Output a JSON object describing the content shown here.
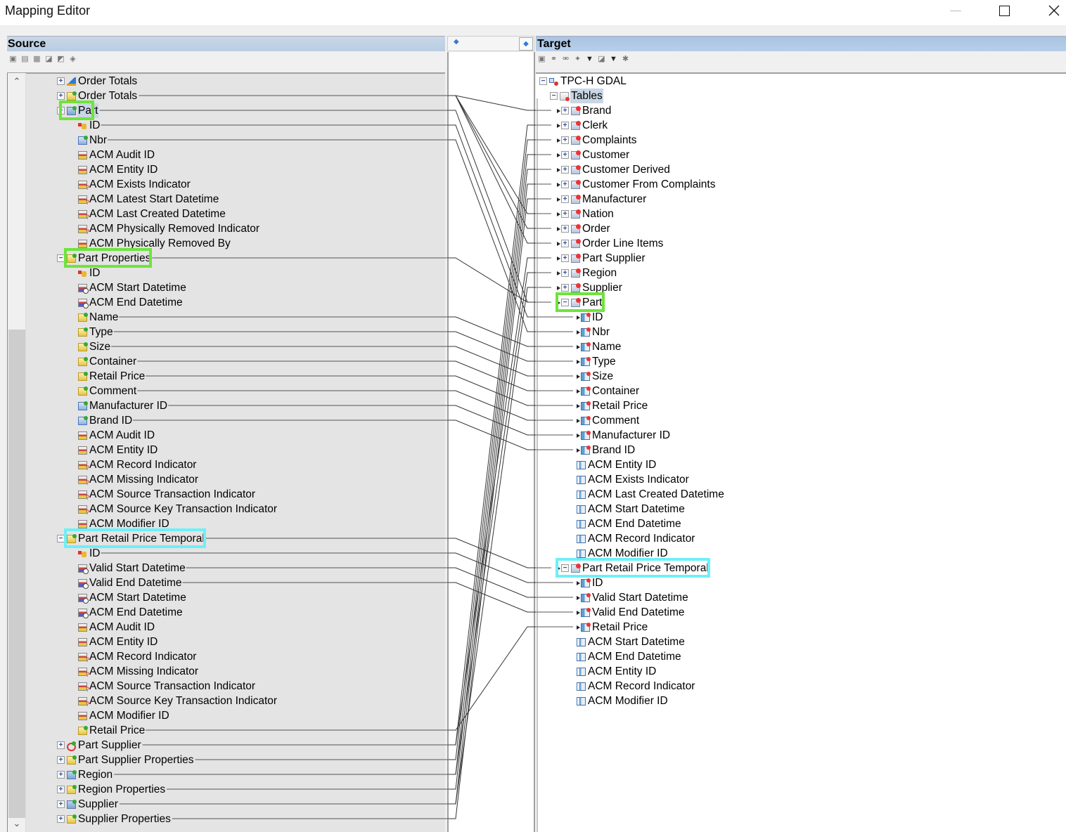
{
  "window": {
    "title": "Mapping Editor",
    "controls": [
      "minimize",
      "maximize",
      "close"
    ]
  },
  "source": {
    "header": "Source",
    "toolbar_icons": [
      "new-entity-icon",
      "new-table-icon",
      "delete-icon",
      "import-icon",
      "export-icon",
      "add-mapping-icon"
    ],
    "rows": [
      {
        "label": "Order Totals",
        "level": 0,
        "expander": "+",
        "icon": "chart",
        "mapped": false
      },
      {
        "label": "Order Totals",
        "level": 0,
        "expander": "+",
        "icon": "props",
        "mapped": true
      },
      {
        "label": "Part",
        "level": 0,
        "expander": "-",
        "icon": "entity",
        "mapped": true,
        "selected": true,
        "highlight": "green"
      },
      {
        "label": "ID",
        "level": 1,
        "icon": "key",
        "mapped": true
      },
      {
        "label": "Nbr",
        "level": 1,
        "icon": "bluefld",
        "mapped": true
      },
      {
        "label": "ACM Audit ID",
        "level": 1,
        "icon": "attr",
        "mapped": false
      },
      {
        "label": "ACM Entity ID",
        "level": 1,
        "icon": "attr",
        "mapped": false
      },
      {
        "label": "ACM Exists Indicator",
        "level": 1,
        "icon": "attrq",
        "mapped": false
      },
      {
        "label": "ACM Latest Start Datetime",
        "level": 1,
        "icon": "attrq",
        "mapped": false
      },
      {
        "label": "ACM Last Created Datetime",
        "level": 1,
        "icon": "attrq",
        "mapped": false
      },
      {
        "label": "ACM Physically Removed Indicator",
        "level": 1,
        "icon": "attrq",
        "mapped": false
      },
      {
        "label": "ACM Physically Removed By",
        "level": 1,
        "icon": "attr",
        "mapped": false
      },
      {
        "label": "Part Properties",
        "level": 0,
        "expander": "-",
        "icon": "props",
        "mapped": true,
        "highlight": "green"
      },
      {
        "label": "ID",
        "level": 1,
        "icon": "key",
        "mapped": false
      },
      {
        "label": "ACM Start Datetime",
        "level": 1,
        "icon": "attrt",
        "mapped": false
      },
      {
        "label": "ACM End Datetime",
        "level": 1,
        "icon": "attrt",
        "mapped": false
      },
      {
        "label": "Name",
        "level": 1,
        "icon": "props",
        "mapped": true
      },
      {
        "label": "Type",
        "level": 1,
        "icon": "props",
        "mapped": true
      },
      {
        "label": "Size",
        "level": 1,
        "icon": "props",
        "mapped": true
      },
      {
        "label": "Container",
        "level": 1,
        "icon": "props",
        "mapped": true
      },
      {
        "label": "Retail Price",
        "level": 1,
        "icon": "props",
        "mapped": true
      },
      {
        "label": "Comment",
        "level": 1,
        "icon": "props",
        "mapped": true
      },
      {
        "label": "Manufacturer ID",
        "level": 1,
        "icon": "bluefld",
        "mapped": true
      },
      {
        "label": "Brand ID",
        "level": 1,
        "icon": "bluefld",
        "mapped": true
      },
      {
        "label": "ACM Audit ID",
        "level": 1,
        "icon": "attr",
        "mapped": false
      },
      {
        "label": "ACM Entity ID",
        "level": 1,
        "icon": "attr",
        "mapped": false
      },
      {
        "label": "ACM Record Indicator",
        "level": 1,
        "icon": "attrq",
        "mapped": false
      },
      {
        "label": "ACM Missing Indicator",
        "level": 1,
        "icon": "attrq",
        "mapped": false
      },
      {
        "label": "ACM Source Transaction Indicator",
        "level": 1,
        "icon": "attrq",
        "mapped": false
      },
      {
        "label": "ACM Source Key Transaction Indicator",
        "level": 1,
        "icon": "attrq",
        "mapped": false
      },
      {
        "label": "ACM Modifier ID",
        "level": 1,
        "icon": "attr",
        "mapped": false
      },
      {
        "label": "Part Retail Price Temporal",
        "level": 0,
        "expander": "-",
        "icon": "props",
        "mapped": true,
        "highlight": "cyan"
      },
      {
        "label": "ID",
        "level": 1,
        "icon": "key",
        "mapped": true
      },
      {
        "label": "Valid Start Datetime",
        "level": 1,
        "icon": "attrt",
        "mapped": true
      },
      {
        "label": "Valid End Datetime",
        "level": 1,
        "icon": "attrt",
        "mapped": true
      },
      {
        "label": "ACM Start Datetime",
        "level": 1,
        "icon": "attrt",
        "mapped": false
      },
      {
        "label": "ACM End Datetime",
        "level": 1,
        "icon": "attrt",
        "mapped": false
      },
      {
        "label": "ACM Audit ID",
        "level": 1,
        "icon": "attr",
        "mapped": false
      },
      {
        "label": "ACM Entity ID",
        "level": 1,
        "icon": "attr",
        "mapped": false
      },
      {
        "label": "ACM Record Indicator",
        "level": 1,
        "icon": "attrq",
        "mapped": false
      },
      {
        "label": "ACM Missing Indicator",
        "level": 1,
        "icon": "attrq",
        "mapped": false
      },
      {
        "label": "ACM Source Transaction Indicator",
        "level": 1,
        "icon": "attrq",
        "mapped": false
      },
      {
        "label": "ACM Source Key Transaction Indicator",
        "level": 1,
        "icon": "attrq",
        "mapped": false
      },
      {
        "label": "ACM Modifier ID",
        "level": 1,
        "icon": "attr",
        "mapped": false
      },
      {
        "label": "Retail Price",
        "level": 1,
        "icon": "props",
        "mapped": true
      },
      {
        "label": "Part Supplier",
        "level": 0,
        "expander": "+",
        "icon": "rel",
        "mapped": true
      },
      {
        "label": "Part Supplier Properties",
        "level": 0,
        "expander": "+",
        "icon": "props",
        "mapped": true
      },
      {
        "label": "Region",
        "level": 0,
        "expander": "+",
        "icon": "entity",
        "mapped": true
      },
      {
        "label": "Region Properties",
        "level": 0,
        "expander": "+",
        "icon": "props",
        "mapped": true
      },
      {
        "label": "Supplier",
        "level": 0,
        "expander": "+",
        "icon": "entity",
        "mapped": true
      },
      {
        "label": "Supplier Properties",
        "level": 0,
        "expander": "+",
        "icon": "props",
        "mapped": true
      }
    ]
  },
  "middle": {
    "left_arrow": "◆",
    "right_arrow": "◆"
  },
  "target": {
    "header": "Target",
    "toolbar_icons": [
      "new-icon",
      "link-icon",
      "unlink-icon",
      "auto-map-icon",
      "dropdown-icon",
      "filter-icon",
      "dropdown-icon",
      "settings-icon"
    ],
    "rows": [
      {
        "label": "TPC-H GDAL",
        "level": 0,
        "expander": "-",
        "icon": "model",
        "mapped": false
      },
      {
        "label": "Tables",
        "level": 1,
        "expander": "-",
        "icon": "folder",
        "mapped": false,
        "selected": true
      },
      {
        "label": "Brand",
        "level": 2,
        "expander": "+",
        "icon": "table",
        "mapped": true
      },
      {
        "label": "Clerk",
        "level": 2,
        "expander": "+",
        "icon": "table",
        "mapped": true
      },
      {
        "label": "Complaints",
        "level": 2,
        "expander": "+",
        "icon": "table",
        "mapped": true
      },
      {
        "label": "Customer",
        "level": 2,
        "expander": "+",
        "icon": "table",
        "mapped": true
      },
      {
        "label": "Customer Derived",
        "level": 2,
        "expander": "+",
        "icon": "table",
        "mapped": true
      },
      {
        "label": "Customer From Complaints",
        "level": 2,
        "expander": "+",
        "icon": "table",
        "mapped": true
      },
      {
        "label": "Manufacturer",
        "level": 2,
        "expander": "+",
        "icon": "table",
        "mapped": true
      },
      {
        "label": "Nation",
        "level": 2,
        "expander": "+",
        "icon": "table",
        "mapped": true
      },
      {
        "label": "Order",
        "level": 2,
        "expander": "+",
        "icon": "table",
        "mapped": true
      },
      {
        "label": "Order Line Items",
        "level": 2,
        "expander": "+",
        "icon": "table",
        "mapped": true
      },
      {
        "label": "Part Supplier",
        "level": 2,
        "expander": "+",
        "icon": "table",
        "mapped": true
      },
      {
        "label": "Region",
        "level": 2,
        "expander": "+",
        "icon": "table",
        "mapped": true
      },
      {
        "label": "Supplier",
        "level": 2,
        "expander": "+",
        "icon": "table",
        "mapped": true
      },
      {
        "label": "Part",
        "level": 2,
        "expander": "-",
        "icon": "table",
        "mapped": true,
        "highlight": "green"
      },
      {
        "label": "ID",
        "level": 3,
        "icon": "col",
        "mapped": true
      },
      {
        "label": "Nbr",
        "level": 3,
        "icon": "col",
        "mapped": true
      },
      {
        "label": "Name",
        "level": 3,
        "icon": "col",
        "mapped": true
      },
      {
        "label": "Type",
        "level": 3,
        "icon": "col",
        "mapped": true
      },
      {
        "label": "Size",
        "level": 3,
        "icon": "col",
        "mapped": true
      },
      {
        "label": "Container",
        "level": 3,
        "icon": "col",
        "mapped": true
      },
      {
        "label": "Retail Price",
        "level": 3,
        "icon": "col",
        "mapped": true
      },
      {
        "label": "Comment",
        "level": 3,
        "icon": "col",
        "mapped": true
      },
      {
        "label": "Manufacturer ID",
        "level": 3,
        "icon": "col",
        "mapped": true
      },
      {
        "label": "Brand ID",
        "level": 3,
        "icon": "col",
        "mapped": true
      },
      {
        "label": "ACM Entity ID",
        "level": 3,
        "icon": "colplain",
        "mapped": false
      },
      {
        "label": "ACM Exists Indicator",
        "level": 3,
        "icon": "colplain",
        "mapped": false
      },
      {
        "label": "ACM Last Created Datetime",
        "level": 3,
        "icon": "colplain",
        "mapped": false
      },
      {
        "label": "ACM Start Datetime",
        "level": 3,
        "icon": "colplain",
        "mapped": false
      },
      {
        "label": "ACM End Datetime",
        "level": 3,
        "icon": "colplain",
        "mapped": false
      },
      {
        "label": "ACM Record Indicator",
        "level": 3,
        "icon": "colplain",
        "mapped": false
      },
      {
        "label": "ACM Modifier ID",
        "level": 3,
        "icon": "colplain",
        "mapped": false
      },
      {
        "label": "Part Retail Price Temporal",
        "level": 2,
        "expander": "-",
        "icon": "table",
        "mapped": true,
        "highlight": "cyan"
      },
      {
        "label": "ID",
        "level": 3,
        "icon": "col",
        "mapped": true
      },
      {
        "label": "Valid Start Datetime",
        "level": 3,
        "icon": "col",
        "mapped": true
      },
      {
        "label": "Valid End Datetime",
        "level": 3,
        "icon": "col",
        "mapped": true
      },
      {
        "label": "Retail Price",
        "level": 3,
        "icon": "col",
        "mapped": true
      },
      {
        "label": "ACM Start Datetime",
        "level": 3,
        "icon": "colplain",
        "mapped": false
      },
      {
        "label": "ACM End Datetime",
        "level": 3,
        "icon": "colplain",
        "mapped": false
      },
      {
        "label": "ACM Entity ID",
        "level": 3,
        "icon": "colplain",
        "mapped": false
      },
      {
        "label": "ACM Record Indicator",
        "level": 3,
        "icon": "colplain",
        "mapped": false
      },
      {
        "label": "ACM Modifier ID",
        "level": 3,
        "icon": "colplain",
        "mapped": false
      }
    ]
  },
  "mappings": [
    [
      2,
      15
    ],
    [
      3,
      16
    ],
    [
      4,
      17
    ],
    [
      12,
      15
    ],
    [
      16,
      18
    ],
    [
      17,
      19
    ],
    [
      18,
      20
    ],
    [
      19,
      21
    ],
    [
      20,
      22
    ],
    [
      21,
      23
    ],
    [
      22,
      24
    ],
    [
      23,
      25
    ],
    [
      31,
      33
    ],
    [
      32,
      34
    ],
    [
      33,
      35
    ],
    [
      34,
      36
    ],
    [
      44,
      37
    ],
    [
      1,
      2
    ],
    [
      45,
      3
    ],
    [
      46,
      4
    ],
    [
      47,
      5
    ],
    [
      48,
      6
    ],
    [
      49,
      7
    ],
    [
      50,
      8
    ],
    [
      1,
      9
    ],
    [
      1,
      10
    ],
    [
      1,
      11
    ],
    [
      45,
      12
    ],
    [
      47,
      13
    ],
    [
      49,
      14
    ]
  ],
  "colors": {
    "highlight_green": "#6ee43c",
    "highlight_cyan": "#6df0f7",
    "source_bg": "#e4e4e4",
    "selection": "#c9d6e4"
  }
}
